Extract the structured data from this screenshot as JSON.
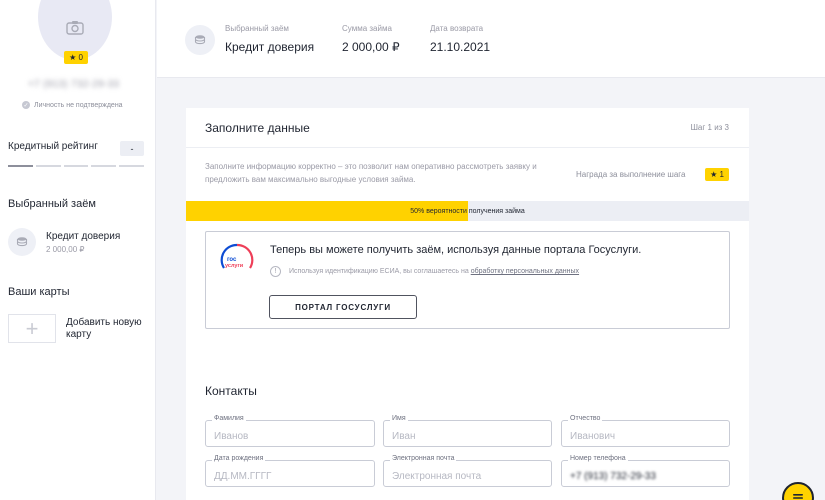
{
  "sidebar": {
    "stars_badge": "★ 0",
    "phone": "+7 (913) 732-29-33",
    "identity_status": "Личность не подтверждена",
    "credit_rating_label": "Кредитный рейтинг",
    "credit_rating_value": "-",
    "selected_loan_title": "Выбранный заём",
    "selected_loan_name": "Кредит доверия",
    "selected_loan_sum": "2 000,00 ₽",
    "cards_title": "Ваши карты",
    "add_card_label": "Добавить новую карту"
  },
  "topbar": {
    "loan_label": "Выбранный заём",
    "loan_value": "Кредит доверия",
    "sum_label": "Сумма займа",
    "sum_value": "2 000,00 ₽",
    "return_label": "Дата возврата",
    "return_value": "21.10.2021"
  },
  "form": {
    "title": "Заполните данные",
    "step": "Шаг 1 из 3",
    "hint": "Заполните информацию корректно – это позволит нам оперативно рассмотреть заявку и предложить вам максимально выгодные условия займа.",
    "reward_label": "Награда за выполнение шага",
    "reward_badge": "★ 1",
    "progress_percent": 50,
    "progress_text": "50% вероятности получения займа"
  },
  "gosuslugi": {
    "logo_text_top": "гос",
    "logo_text_bottom": "услуги",
    "title": "Теперь вы можете получить заём, используя данные портала Госуслуги.",
    "note_prefix": "Используя идентификацию ЕСИА, вы соглашаетесь на",
    "note_link": "обработку персональных данных",
    "button_label": "ПОРТАЛ ГОСУСЛУГИ"
  },
  "contacts": {
    "title": "Контакты",
    "fields": {
      "last_name": {
        "label": "Фамилия",
        "placeholder": "Иванов"
      },
      "first_name": {
        "label": "Имя",
        "placeholder": "Иван"
      },
      "patronymic": {
        "label": "Отчество",
        "placeholder": "Иванович"
      },
      "birth_date": {
        "label": "Дата рождения",
        "placeholder": "ДД.ММ.ГГГГ"
      },
      "email": {
        "label": "Электронная почта",
        "placeholder": "Электронная почта"
      },
      "phone": {
        "label": "Номер телефона",
        "value": "+7 (913) 732-29-33"
      }
    }
  },
  "colors": {
    "accent": "#ffd200",
    "text": "#1f2430",
    "muted": "#9a9aa6",
    "background": "#f3f4f8",
    "gosuslugi_blue": "#0d4cd3",
    "gosuslugi_red": "#ee3f58"
  },
  "icons": {
    "avatar": "camera-icon",
    "loan": "coins-icon",
    "chat": "chat-icon"
  }
}
